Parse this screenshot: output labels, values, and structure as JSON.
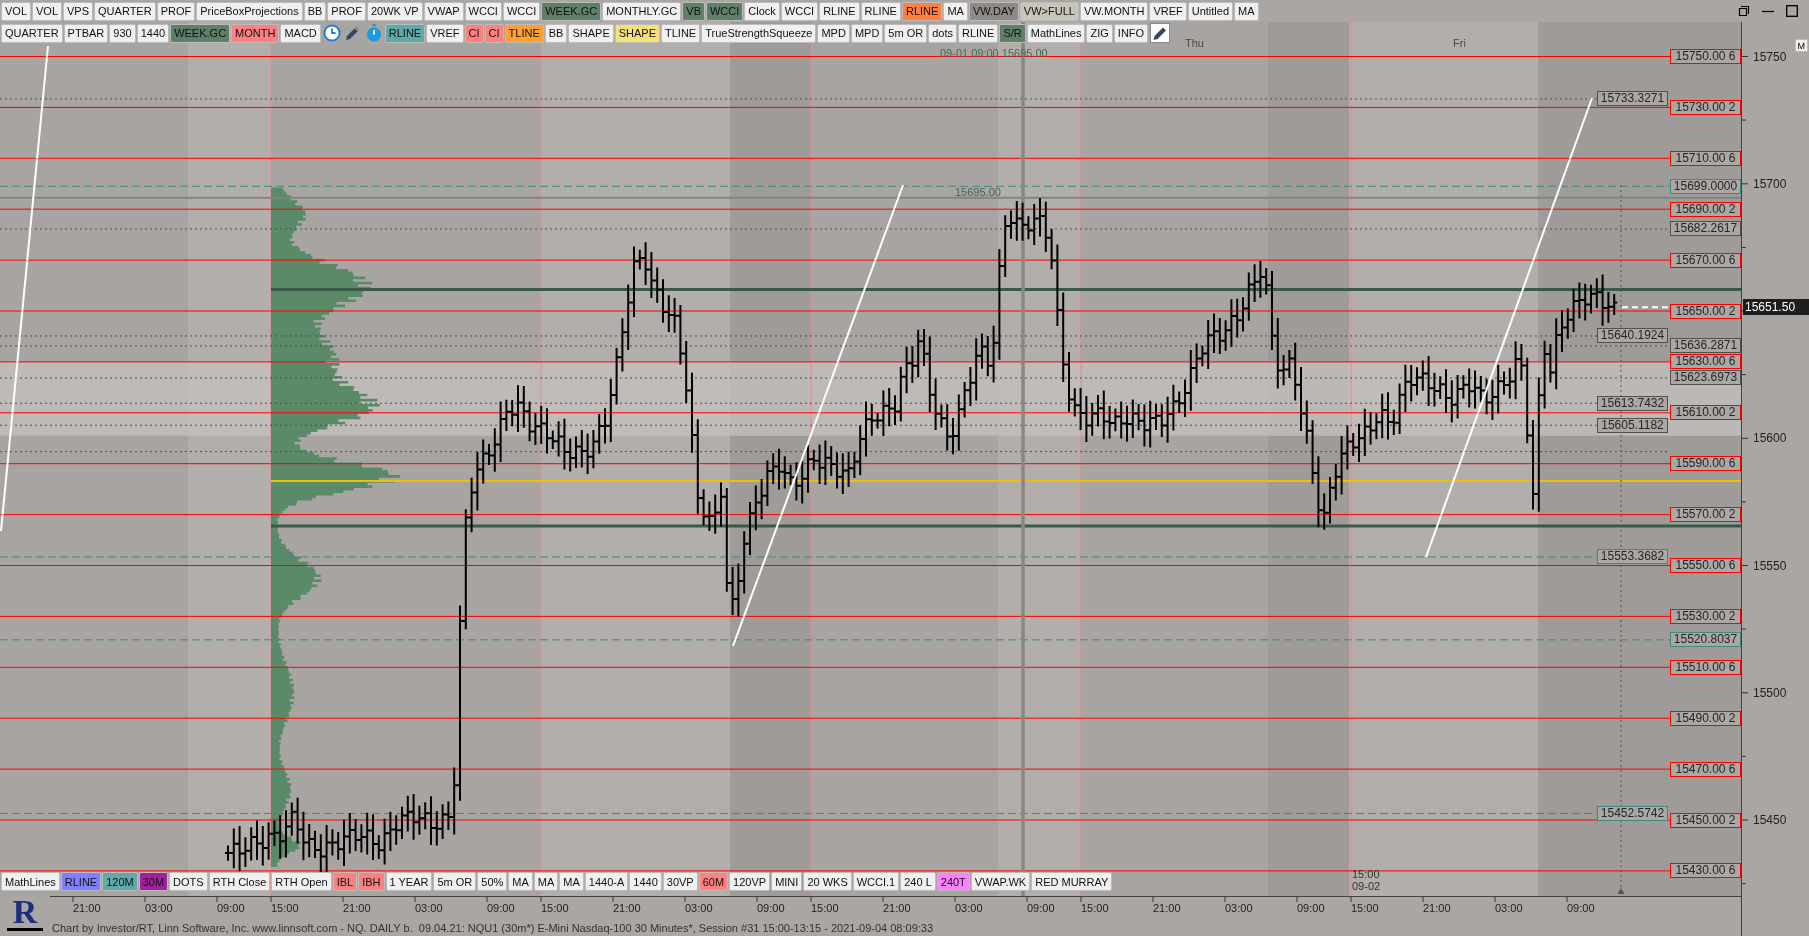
{
  "toolbar_top": [
    {
      "label": "VOL"
    },
    {
      "label": "VOL"
    },
    {
      "label": "VPS"
    },
    {
      "label": "QUARTER"
    },
    {
      "label": "PROF"
    },
    {
      "label": "PriceBoxProjections"
    },
    {
      "label": "BB"
    },
    {
      "label": "PROF"
    },
    {
      "label": "20WK VP"
    },
    {
      "label": "VWAP"
    },
    {
      "label": "WCCI"
    },
    {
      "label": "WCCI"
    },
    {
      "label": "WEEK.GC",
      "color": "#5f7f69"
    },
    {
      "label": "MONTHLY.GC"
    },
    {
      "label": "VB",
      "color": "#5f7f69"
    },
    {
      "label": "WCCI",
      "color": "#5f7f69"
    },
    {
      "label": "Clock"
    },
    {
      "label": "WCCI"
    },
    {
      "label": "RLINE"
    },
    {
      "label": "RLINE"
    },
    {
      "label": "RLINE",
      "color": "#ff7f3f"
    },
    {
      "label": "MA"
    },
    {
      "label": "VW.DAY",
      "color": "#8f8a88"
    },
    {
      "label": "VW>FULL",
      "color": "#c9c5b9"
    },
    {
      "label": "VW.MONTH"
    },
    {
      "label": "VREF"
    },
    {
      "label": "Untitled"
    },
    {
      "label": "MA"
    }
  ],
  "toolbar_chart": {
    "left": [
      {
        "label": "QUARTER"
      },
      {
        "label": "PTBAR"
      },
      {
        "label": "930"
      },
      {
        "label": "1440"
      },
      {
        "label": "WEEK.GC",
        "color": "#5f7f69"
      },
      {
        "label": "MONTH",
        "color": "#ff8080"
      },
      {
        "label": "MACD"
      }
    ],
    "right": [
      {
        "label": "RLINE",
        "color": "#5fa9a9"
      },
      {
        "label": "VREF"
      },
      {
        "label": "CI",
        "color": "#ff8080"
      },
      {
        "label": "CI",
        "color": "#ff8080"
      },
      {
        "label": "TLINE",
        "color": "#ffa030"
      },
      {
        "label": "BB"
      },
      {
        "label": "SHAPE"
      },
      {
        "label": "SHAPE",
        "color": "#f5e07a"
      },
      {
        "label": "TLINE"
      },
      {
        "label": "TrueStrengthSqueeze"
      },
      {
        "label": "MPD"
      },
      {
        "label": "MPD"
      },
      {
        "label": "5m OR"
      },
      {
        "label": "dots"
      },
      {
        "label": "RLINE"
      },
      {
        "label": "S/R",
        "color": "#5f7f69"
      },
      {
        "label": "MathLines"
      },
      {
        "label": "ZIG"
      },
      {
        "label": "INFO"
      }
    ]
  },
  "chart": {
    "day_labels": [
      "Thu",
      "Fri"
    ],
    "crosshair_label": "09-01 09:00 15695.00",
    "high_label": "15695.00",
    "session_marker": [
      "15:00",
      "09-02"
    ],
    "corner_button": "M",
    "levels": [
      {
        "label": "15750.00 6",
        "kind": "line",
        "color": "#ff0000"
      },
      {
        "label": "15733.3271",
        "kind": "dotted",
        "color": "#505050"
      },
      {
        "label": "15730.00 2",
        "kind": "line",
        "color": "#ff0000"
      },
      {
        "label": "15710.00 6",
        "kind": "line",
        "color": "#ff0000"
      },
      {
        "label": "15699.0000",
        "kind": "dashed",
        "color": "#3f8a80"
      },
      {
        "label": "15690.00 2",
        "kind": "line",
        "color": "#ff0000"
      },
      {
        "label": "15682.2617",
        "kind": "dotted",
        "color": "#505050"
      },
      {
        "label": "15670.00 6",
        "kind": "line",
        "color": "#ff0000"
      },
      {
        "label": "15650.00 2",
        "kind": "line",
        "color": "#ff0000"
      },
      {
        "label": "15640.1924",
        "kind": "dotted",
        "color": "#505050"
      },
      {
        "label": "15636.2871",
        "kind": "dotted",
        "color": "#505050"
      },
      {
        "label": "15630.00 6",
        "kind": "line",
        "color": "#ff0000"
      },
      {
        "label": "15623.6973",
        "kind": "dotted",
        "color": "#505050"
      },
      {
        "label": "15613.7432",
        "kind": "dotted",
        "color": "#505050"
      },
      {
        "label": "15610.00 2",
        "kind": "line",
        "color": "#ff0000"
      },
      {
        "label": "15605.1182",
        "kind": "dotted",
        "color": "#505050"
      },
      {
        "label": "15590.00 6",
        "kind": "line",
        "color": "#ff0000"
      },
      {
        "label": "15570.00 2",
        "kind": "line",
        "color": "#ff0000"
      },
      {
        "label": "15553.3682",
        "kind": "dashed",
        "color": "#3f8a80"
      },
      {
        "label": "15550.00 6",
        "kind": "line",
        "color": "#ff0000"
      },
      {
        "label": "15530.00 2",
        "kind": "line",
        "color": "#ff0000"
      },
      {
        "label": "15520.8037",
        "kind": "dashed",
        "color": "#3f8a80"
      },
      {
        "label": "15510.00 6",
        "kind": "line",
        "color": "#ff0000"
      },
      {
        "label": "15490.00 2",
        "kind": "line",
        "color": "#ff0000"
      },
      {
        "label": "15470.00 6",
        "kind": "line",
        "color": "#ff0000"
      },
      {
        "label": "15452.5742",
        "kind": "dashed",
        "color": "#3f8a80"
      },
      {
        "label": "15450.00 2",
        "kind": "line",
        "color": "#ff0000"
      },
      {
        "label": "15430.00 6",
        "kind": "line",
        "color": "#ff0000"
      }
    ]
  },
  "price_axis": {
    "ticks": [
      "15750",
      "15700",
      "15600",
      "15550",
      "15500",
      "15450"
    ],
    "last_price": "15651.50"
  },
  "toolbar_bottom": [
    {
      "label": "MathLines"
    },
    {
      "label": "RLINE",
      "color": "#8080ff"
    },
    {
      "label": "120M",
      "color": "#5fa9a9"
    },
    {
      "label": "30M",
      "color": "#a020a0"
    },
    {
      "label": "DOTS"
    },
    {
      "label": "RTH Close"
    },
    {
      "label": "RTH Open"
    },
    {
      "label": "IBL",
      "color": "#ff8080"
    },
    {
      "label": "IBH",
      "color": "#ff8080"
    },
    {
      "label": "1 YEAR"
    },
    {
      "label": "5m OR"
    },
    {
      "label": "50%"
    },
    {
      "label": "MA"
    },
    {
      "label": "MA"
    },
    {
      "label": "MA"
    },
    {
      "label": "1440-A"
    },
    {
      "label": "1440"
    },
    {
      "label": "30VP"
    },
    {
      "label": "60M",
      "color": "#ff8080"
    },
    {
      "label": "120VP"
    },
    {
      "label": "MINI"
    },
    {
      "label": "20 WKS"
    },
    {
      "label": "WCCI.1"
    },
    {
      "label": "240 L"
    },
    {
      "label": "240T",
      "color": "#ff80ff"
    },
    {
      "label": "VWAP.WK"
    },
    {
      "label": "RED MURRAY"
    }
  ],
  "time_axis": {
    "ticks": [
      "21:00",
      "03:00",
      "09:00",
      "15:00",
      "21:00",
      "03:00",
      "09:00",
      "15:00",
      "21:00",
      "03:00",
      "09:00",
      "15:00",
      "21:00",
      "03:00",
      "09:00",
      "15:00",
      "21:00",
      "03:00",
      "09:00",
      "15:00",
      "21:00",
      "03:00",
      "09:00"
    ]
  },
  "status_bar": {
    "logo": "R",
    "text": "Chart by Investor/RT, Linn Software, Inc. www.linnsoft.com - NQ. DAILY b.  09.04.21: NQU1 (30m*) E-Mini Nasdaq-100 30 Minutes*, Session #31 15:00-13:15 - 2021-09-04 08:09:33"
  }
}
